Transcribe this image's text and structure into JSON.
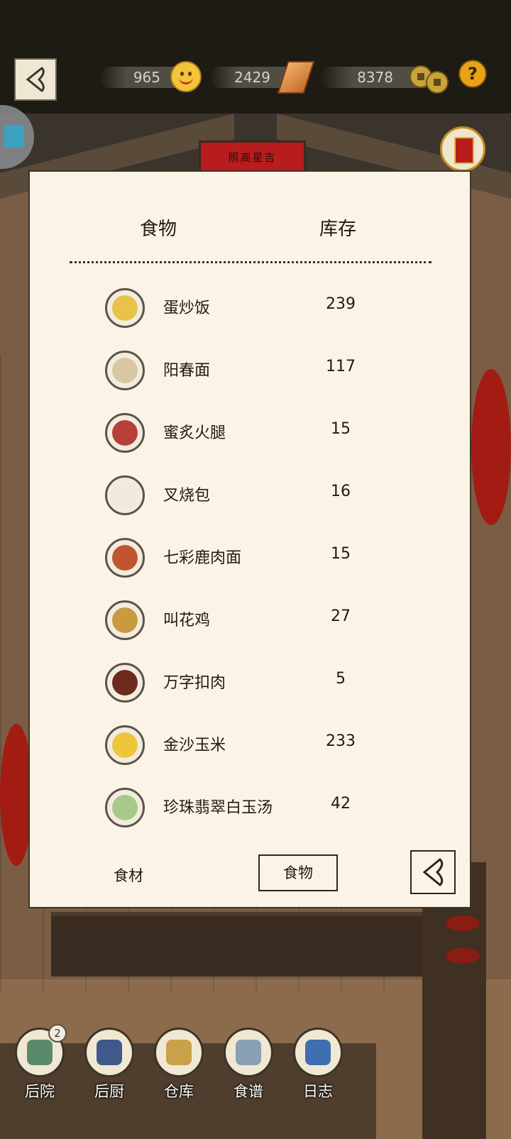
{
  "hud": {
    "resources": [
      {
        "name": "smile-points",
        "value": "965",
        "icon": "smile-face-icon"
      },
      {
        "name": "gold-ingot",
        "value": "2429",
        "icon": "gold-ingot-icon"
      },
      {
        "name": "copper-coins",
        "value": "8378",
        "icon": "copper-coins-icon"
      }
    ],
    "help_label": "?",
    "sign_text": "照高星吉"
  },
  "inventory": {
    "header_food": "食物",
    "header_stock": "库存",
    "items": [
      {
        "name": "蛋炒饭",
        "stock": "239",
        "color": "#e9c24a"
      },
      {
        "name": "阳春面",
        "stock": "117",
        "color": "#d9c7a4"
      },
      {
        "name": "蜜炙火腿",
        "stock": "15",
        "color": "#b8403a"
      },
      {
        "name": "叉烧包",
        "stock": "16",
        "color": "#f2e9dd"
      },
      {
        "name": "七彩鹿肉面",
        "stock": "15",
        "color": "#c1552f"
      },
      {
        "name": "叫花鸡",
        "stock": "27",
        "color": "#c99a3f"
      },
      {
        "name": "万字扣肉",
        "stock": "5",
        "color": "#6e2a1e"
      },
      {
        "name": "金沙玉米",
        "stock": "233",
        "color": "#efc53a"
      },
      {
        "name": "珍珠翡翠白玉汤",
        "stock": "42",
        "color": "#a9c98a"
      }
    ],
    "tab_ingredients": "食材",
    "tab_food": "食物"
  },
  "nav": {
    "badge": "2",
    "items": [
      {
        "label": "后院",
        "color": "#5b8a6a"
      },
      {
        "label": "后厨",
        "color": "#3f5a8a"
      },
      {
        "label": "仓库",
        "color": "#c9a14a"
      },
      {
        "label": "食谱",
        "color": "#8aa0b5"
      },
      {
        "label": "日志",
        "color": "#3e6fb0"
      }
    ]
  }
}
